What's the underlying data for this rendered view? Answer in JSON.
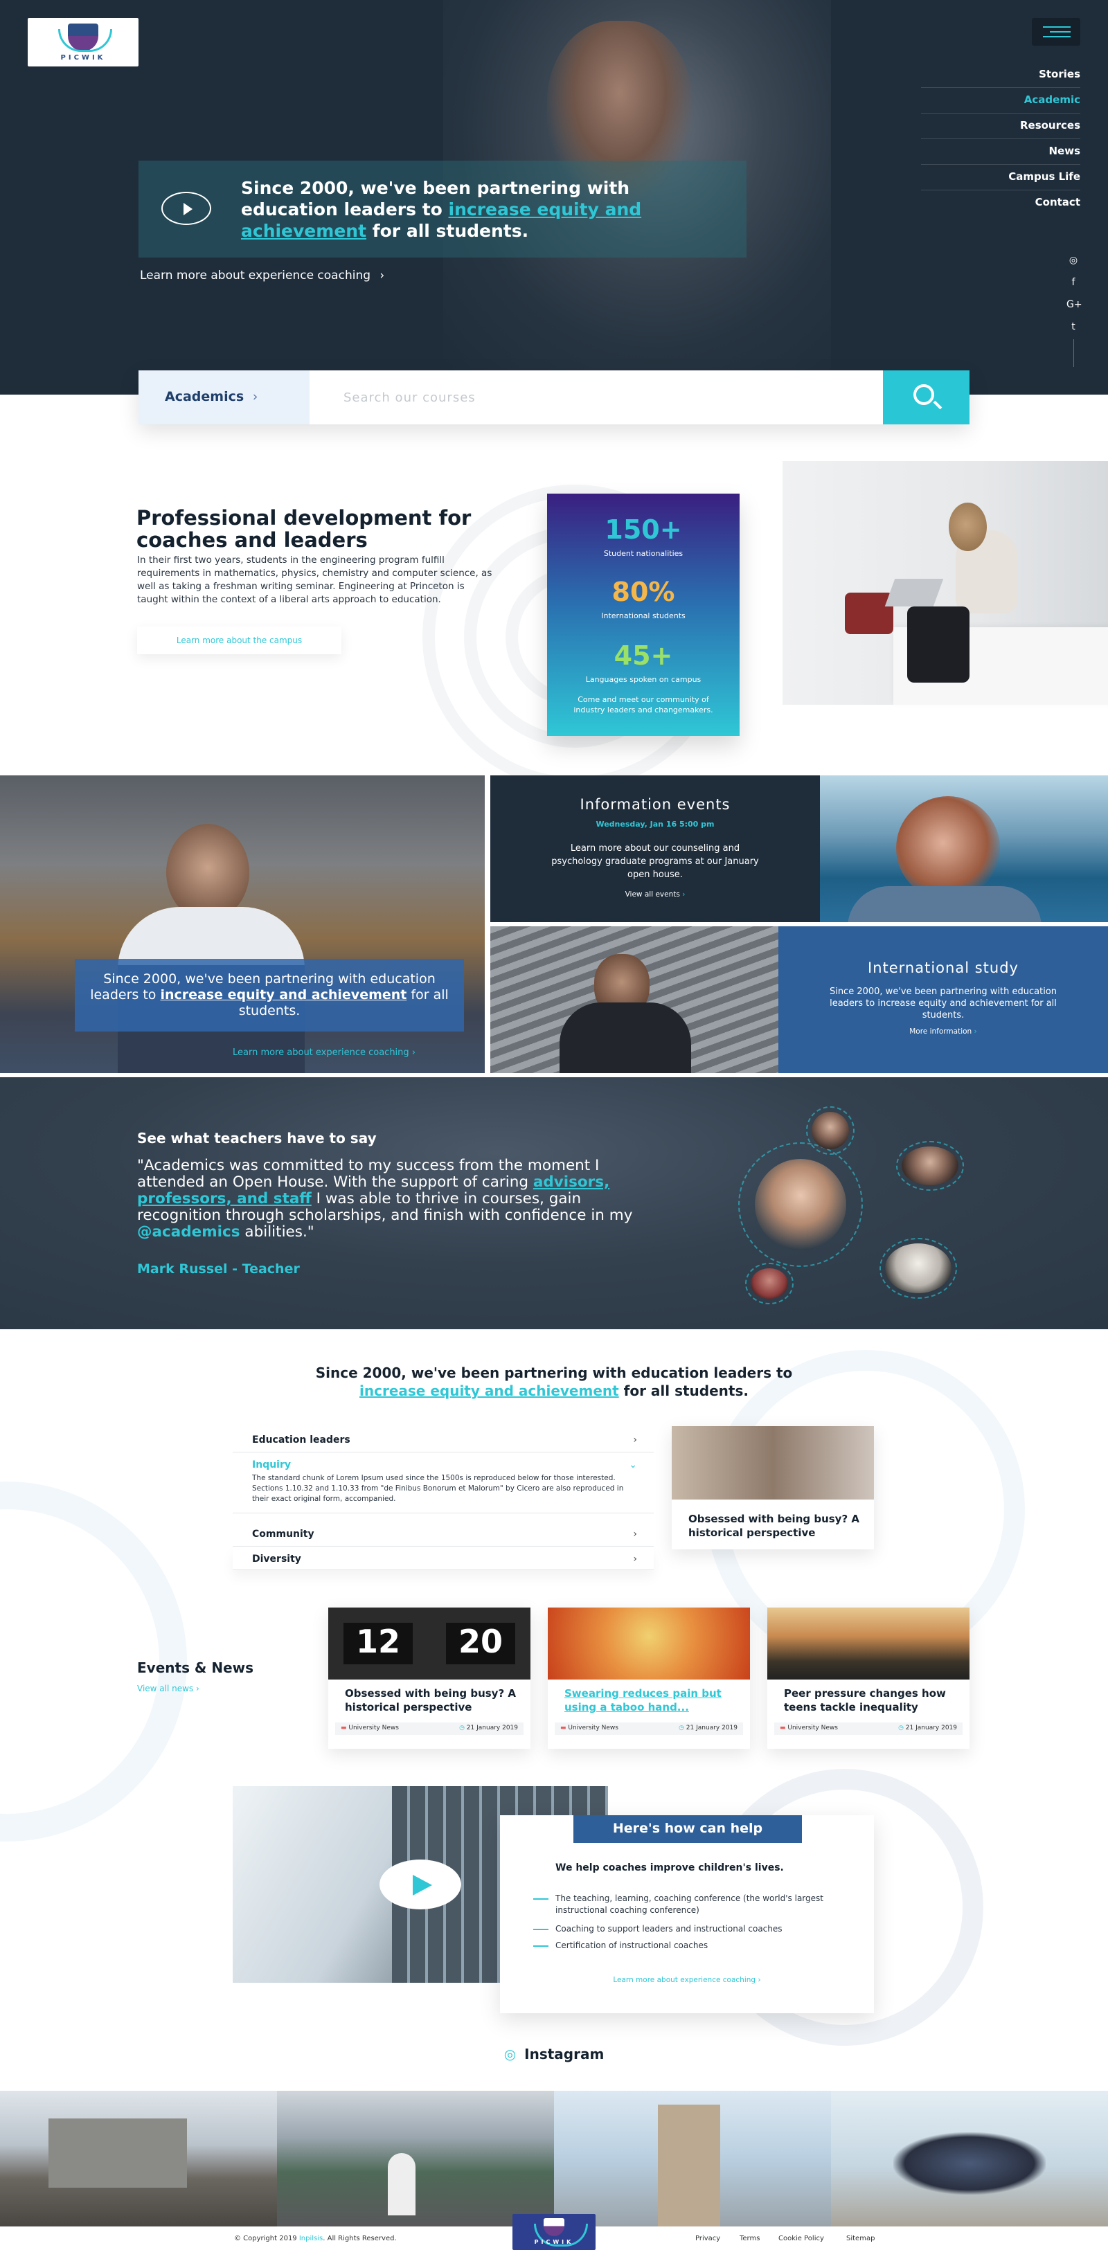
{
  "brand": {
    "name": "PICWIK",
    "accent": "#2fc7d6",
    "dark": "#1f2d3b",
    "blue": "#3066aa"
  },
  "nav": {
    "items": [
      "Stories",
      "Academic",
      "Resources",
      "News",
      "Campus Life",
      "Contact"
    ],
    "active": "Academic"
  },
  "social": {
    "icons": [
      "instagram-icon",
      "facebook-icon",
      "google-plus-icon",
      "twitter-icon"
    ]
  },
  "hero": {
    "text_before": "Since 2000, we've been partnering with education leaders to ",
    "text_link": "increase equity and achievement",
    "text_after": " for all students.",
    "link": "Learn more about experience coaching"
  },
  "search": {
    "category": "Academics",
    "placeholder": "Search our courses"
  },
  "prodev": {
    "title": "Professional development for coaches and leaders",
    "body": "In their first two years, students in the engineering program fulfill requirements in mathematics, physics, chemistry and computer science, as well as taking a freshman writing seminar. Engineering at Princeton is taught within the context of a liberal arts approach to education.",
    "button": "Learn more about the campus"
  },
  "stats": [
    {
      "value": "150+",
      "label": "Student nationalities",
      "color": "#2fc7d6"
    },
    {
      "value": "80%",
      "label": "International students",
      "color": "#f5b74a"
    },
    {
      "value": "45+",
      "label": "Languages spoken on campus",
      "color": "#9be067"
    }
  ],
  "stats_note": "Come and meet our community of industry leaders and changemakers.",
  "grid": {
    "left_text_before": "Since 2000, we've been partnering with education leaders to ",
    "left_text_link": "increase equity and achievement",
    "left_text_after": " for all students.",
    "left_link": "Learn more about experience coaching",
    "info_title": "Information events",
    "info_date": "Wednesday, Jan 16 5:00 pm",
    "info_body": "Learn more about our counseling and psychology graduate programs at our January open house.",
    "info_link": "View all events",
    "intl_title": "International study",
    "intl_body": "Since 2000, we've been partnering with education leaders to increase equity and achievement for all students.",
    "intl_link": "More information"
  },
  "testimonial": {
    "heading": "See what teachers have to say",
    "quote_1": "\"Academics was committed to my success from the moment I attended an Open House. With the support of caring ",
    "quote_link": "advisors, professors, and staff",
    "quote_2": " I was able to thrive in courses, gain recognition through scholarships, and finish with confidence in my ",
    "quote_handle": "@academics",
    "quote_3": " abilities.\"",
    "author": "Mark Russel - Teacher"
  },
  "mission": {
    "text_before": "Since 2000, we've been partnering with education leaders to",
    "text_link": "increase equity and achievement",
    "text_after": " for all students."
  },
  "accordion": {
    "items": [
      "Education leaders",
      "Inquiry",
      "Community",
      "Diversity"
    ],
    "open_body": "The standard chunk of Lorem Ipsum used since the 1500s is reproduced below for those interested. Sections 1.10.32 and 1.10.33 from \"de Finibus Bonorum et Malorum\" by Cicero are also reproduced in their exact original form, accompanied.",
    "card_title": "Obsessed with being busy? A historical perspective"
  },
  "events": {
    "title": "Events & News",
    "link": "View all news",
    "items": [
      {
        "title": "Obsessed with being busy? A historical perspective",
        "category": "University News",
        "date": "21 January 2019"
      },
      {
        "title": "Swearing reduces pain but using a taboo hand...",
        "category": "University News",
        "date": "21 January 2019"
      },
      {
        "title": "Peer pressure changes how teens tackle inequality",
        "category": "University News",
        "date": "21 January 2019"
      }
    ]
  },
  "help": {
    "badge": "Here's how can help",
    "subtitle": "We help coaches improve children's lives.",
    "items": [
      "The teaching, learning, coaching conference (the world's largest instructional coaching conference)",
      "Coaching to support leaders and instructional coaches",
      "Certification of instructional coaches"
    ],
    "link": "Learn more about experience coaching"
  },
  "instagram": {
    "title": "Instagram"
  },
  "footer": {
    "copyright": "© Copyright 2019 ",
    "copyright_brand": "Inpilsis",
    "copyright_after": ". All Rights Reserved.",
    "links": [
      "Privacy",
      "Terms",
      "Cookie Policy",
      "Sitemap"
    ]
  }
}
